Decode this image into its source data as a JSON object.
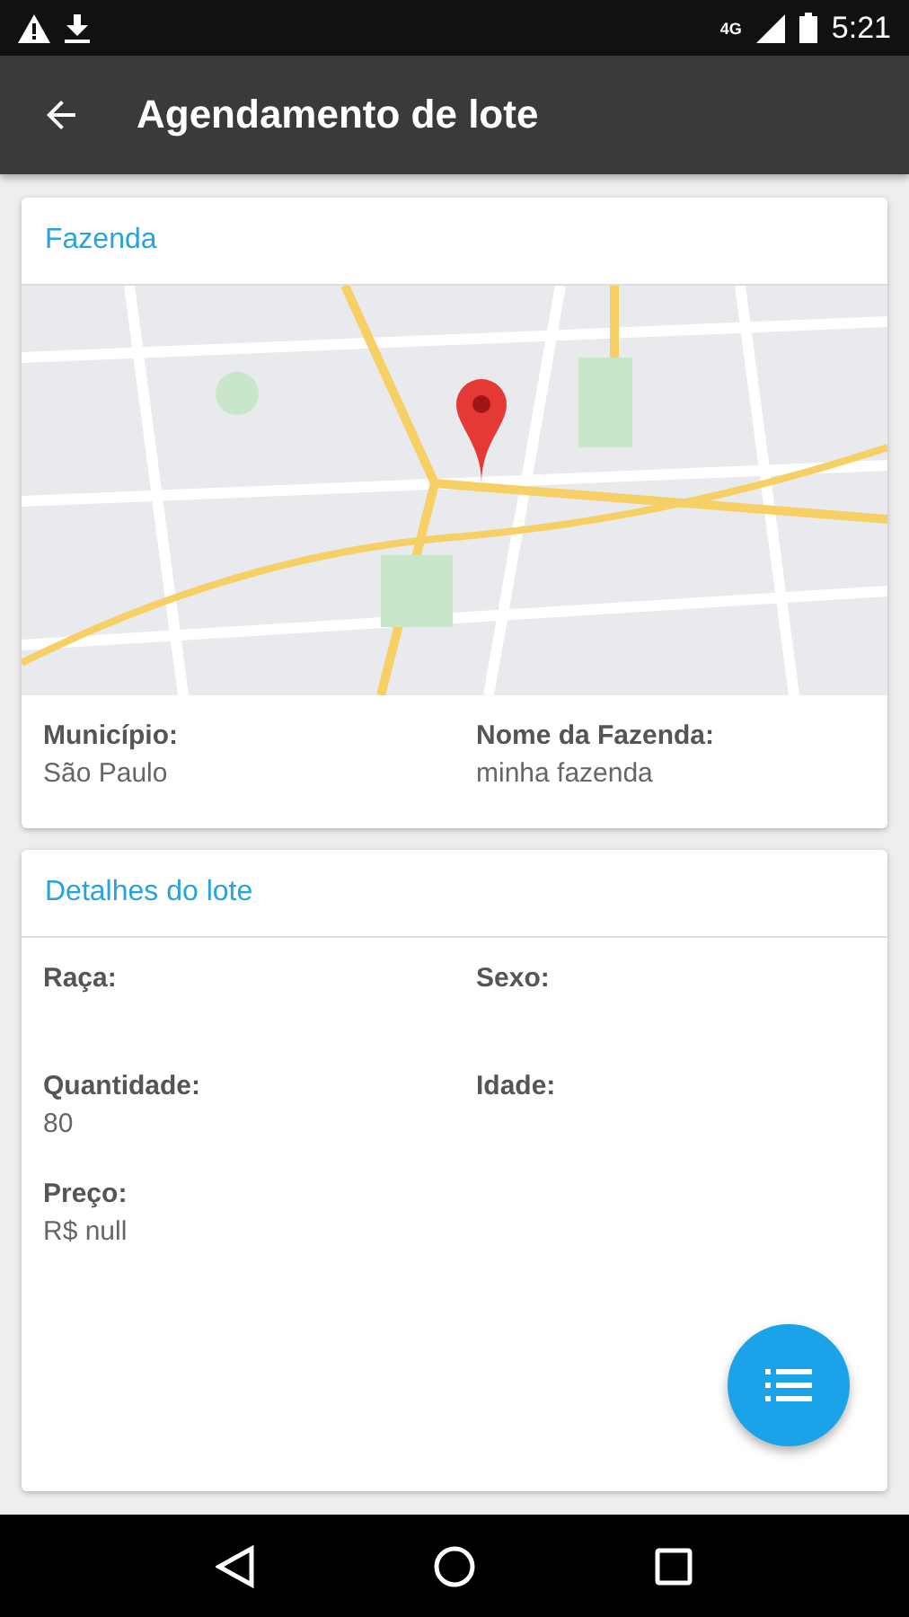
{
  "status_bar": {
    "network": "4G",
    "time": "5:21"
  },
  "app_bar": {
    "title": "Agendamento de lote"
  },
  "farm_card": {
    "title": "Fazenda",
    "fields": [
      {
        "label": "Município:",
        "value": "São Paulo"
      },
      {
        "label": "Nome da Fazenda:",
        "value": "minha fazenda"
      }
    ]
  },
  "lot_card": {
    "title": "Detalhes do lote",
    "fields": [
      {
        "label": "Raça:"
      },
      {
        "label": "Sexo:"
      },
      {
        "label": "Quantidade:",
        "value": "80"
      },
      {
        "label": "Idade:"
      },
      {
        "label": "Preço:",
        "value": "R$ null"
      }
    ]
  }
}
